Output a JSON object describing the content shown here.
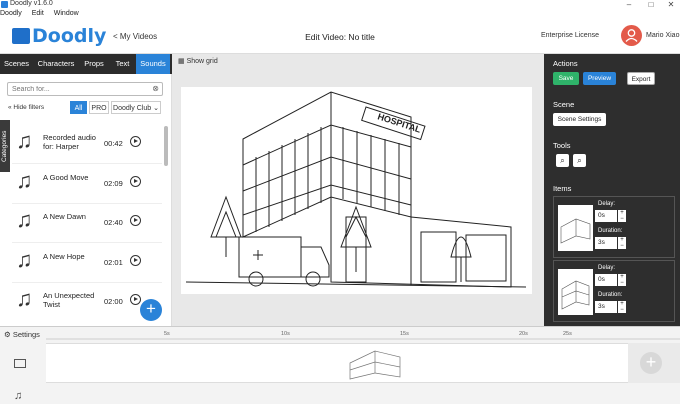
{
  "window": {
    "title": "Doodly v1.6.0",
    "controls": [
      "–",
      "□",
      "✕"
    ]
  },
  "menu": [
    "Doodly",
    "Edit",
    "Window"
  ],
  "header": {
    "logo_text": "Doodly",
    "back_label": "< My Videos",
    "edit_title": "Edit Video: No title",
    "license": "Enterprise License",
    "username": "Mario Xiao"
  },
  "tabs": [
    {
      "label": "Scenes",
      "active": false
    },
    {
      "label": "Characters",
      "active": false
    },
    {
      "label": "Props",
      "active": false
    },
    {
      "label": "Text",
      "active": false
    },
    {
      "label": "Sounds",
      "active": true
    }
  ],
  "search": {
    "placeholder": "Search for..."
  },
  "filters": {
    "hide_label": "« Hide filters",
    "buttons": [
      "All",
      "PRO",
      "Doodly Club ⌄"
    ]
  },
  "categories_label": "Categories",
  "sounds": [
    {
      "name": "Recorded audio for: Harper",
      "duration": "00:42"
    },
    {
      "name": "A Good Move",
      "duration": "02:09"
    },
    {
      "name": "A New Dawn",
      "duration": "02:40"
    },
    {
      "name": "A New Hope",
      "duration": "02:01"
    },
    {
      "name": "An Unexpected Twist",
      "duration": "02:00"
    }
  ],
  "canvas": {
    "show_grid_label": "Show grid",
    "sign_text": "HOSPITAL"
  },
  "right_panel": {
    "actions_label": "Actions",
    "save_label": "Save",
    "preview_label": "Preview",
    "export_label": "Export",
    "scene_label": "Scene",
    "scene_settings_label": "Scene Settings",
    "tools_label": "Tools",
    "items_label": "Items",
    "items": [
      {
        "delay_label": "Delay:",
        "delay": "0s",
        "duration_label": "Duration:",
        "duration": "3s"
      },
      {
        "delay_label": "Delay:",
        "delay": "0s",
        "duration_label": "Duration:",
        "duration": "3s"
      }
    ]
  },
  "timeline": {
    "settings_label": "Settings",
    "ticks": [
      "5s",
      "10s",
      "15s",
      "20s",
      "25s"
    ]
  },
  "colors": {
    "accent": "#2a83d8",
    "save": "#2fb36a",
    "preview": "#2a83d8",
    "dark_panel": "#2e2e2e"
  }
}
